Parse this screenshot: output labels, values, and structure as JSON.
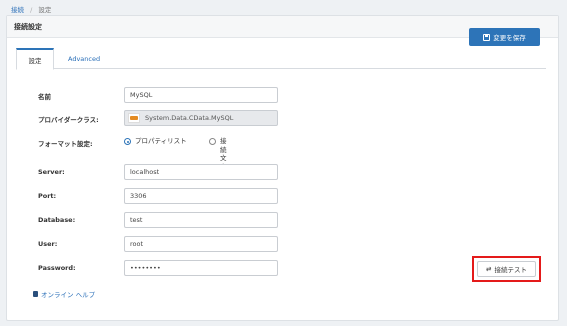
{
  "breadcrumb": {
    "parent": "接続",
    "current": "設定"
  },
  "panel": {
    "title": "接続設定"
  },
  "toolbar": {
    "save_label": "変更を保存"
  },
  "tabs": [
    {
      "label": "設定",
      "active": true
    },
    {
      "label": "Advanced",
      "active": false
    }
  ],
  "form": {
    "name": {
      "label": "名前",
      "value": "MySQL"
    },
    "provider_class": {
      "label": "プロバイダークラス:",
      "value": "System.Data.CData.MySQL"
    },
    "format": {
      "label": "フォーマット設定:",
      "options": [
        "プロパティリスト",
        "接続文字列"
      ],
      "selected": "プロパティリスト"
    },
    "server": {
      "label": "Server:",
      "value": "localhost"
    },
    "port": {
      "label": "Port:",
      "value": "3306"
    },
    "database": {
      "label": "Database:",
      "value": "test"
    },
    "user": {
      "label": "User:",
      "value": "root"
    },
    "password": {
      "label": "Password:",
      "value": "••••••••"
    }
  },
  "actions": {
    "test_label": "接続テスト"
  },
  "help": {
    "label": "オンライン ヘルプ"
  },
  "colors": {
    "accent": "#2d74b8",
    "highlight": "#e41a1a"
  }
}
